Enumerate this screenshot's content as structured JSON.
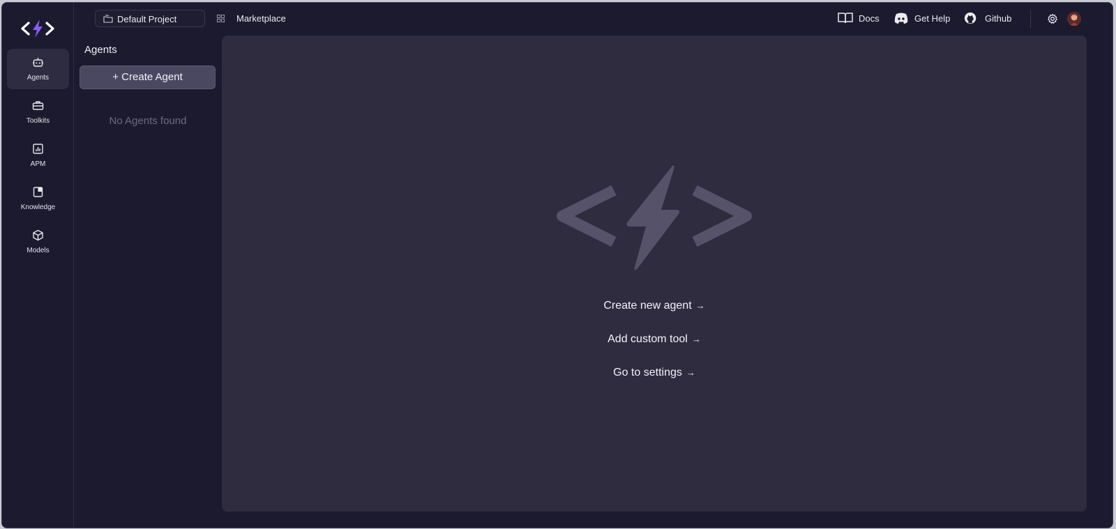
{
  "rail": {
    "items": [
      {
        "label": "Agents",
        "icon": "robot-icon",
        "active": true
      },
      {
        "label": "Toolkits",
        "icon": "toolbox-icon",
        "active": false
      },
      {
        "label": "APM",
        "icon": "chart-icon",
        "active": false
      },
      {
        "label": "Knowledge",
        "icon": "book-icon",
        "active": false
      },
      {
        "label": "Models",
        "icon": "cube-icon",
        "active": false
      }
    ]
  },
  "topbar": {
    "project": "Default Project",
    "marketplace": "Marketplace",
    "docs": "Docs",
    "help": "Get Help",
    "github": "Github"
  },
  "agents_panel": {
    "title": "Agents",
    "create_label": "+ Create Agent",
    "empty_text": "No Agents found"
  },
  "main": {
    "actions": [
      {
        "label": "Create new agent",
        "arrow": "→"
      },
      {
        "label": "Add custom tool",
        "arrow": "→"
      },
      {
        "label": "Go to settings",
        "arrow": "→"
      }
    ]
  },
  "colors": {
    "accent": "#8b5cf6",
    "background": "#1b1a2e",
    "panel": "#2f2c40"
  }
}
